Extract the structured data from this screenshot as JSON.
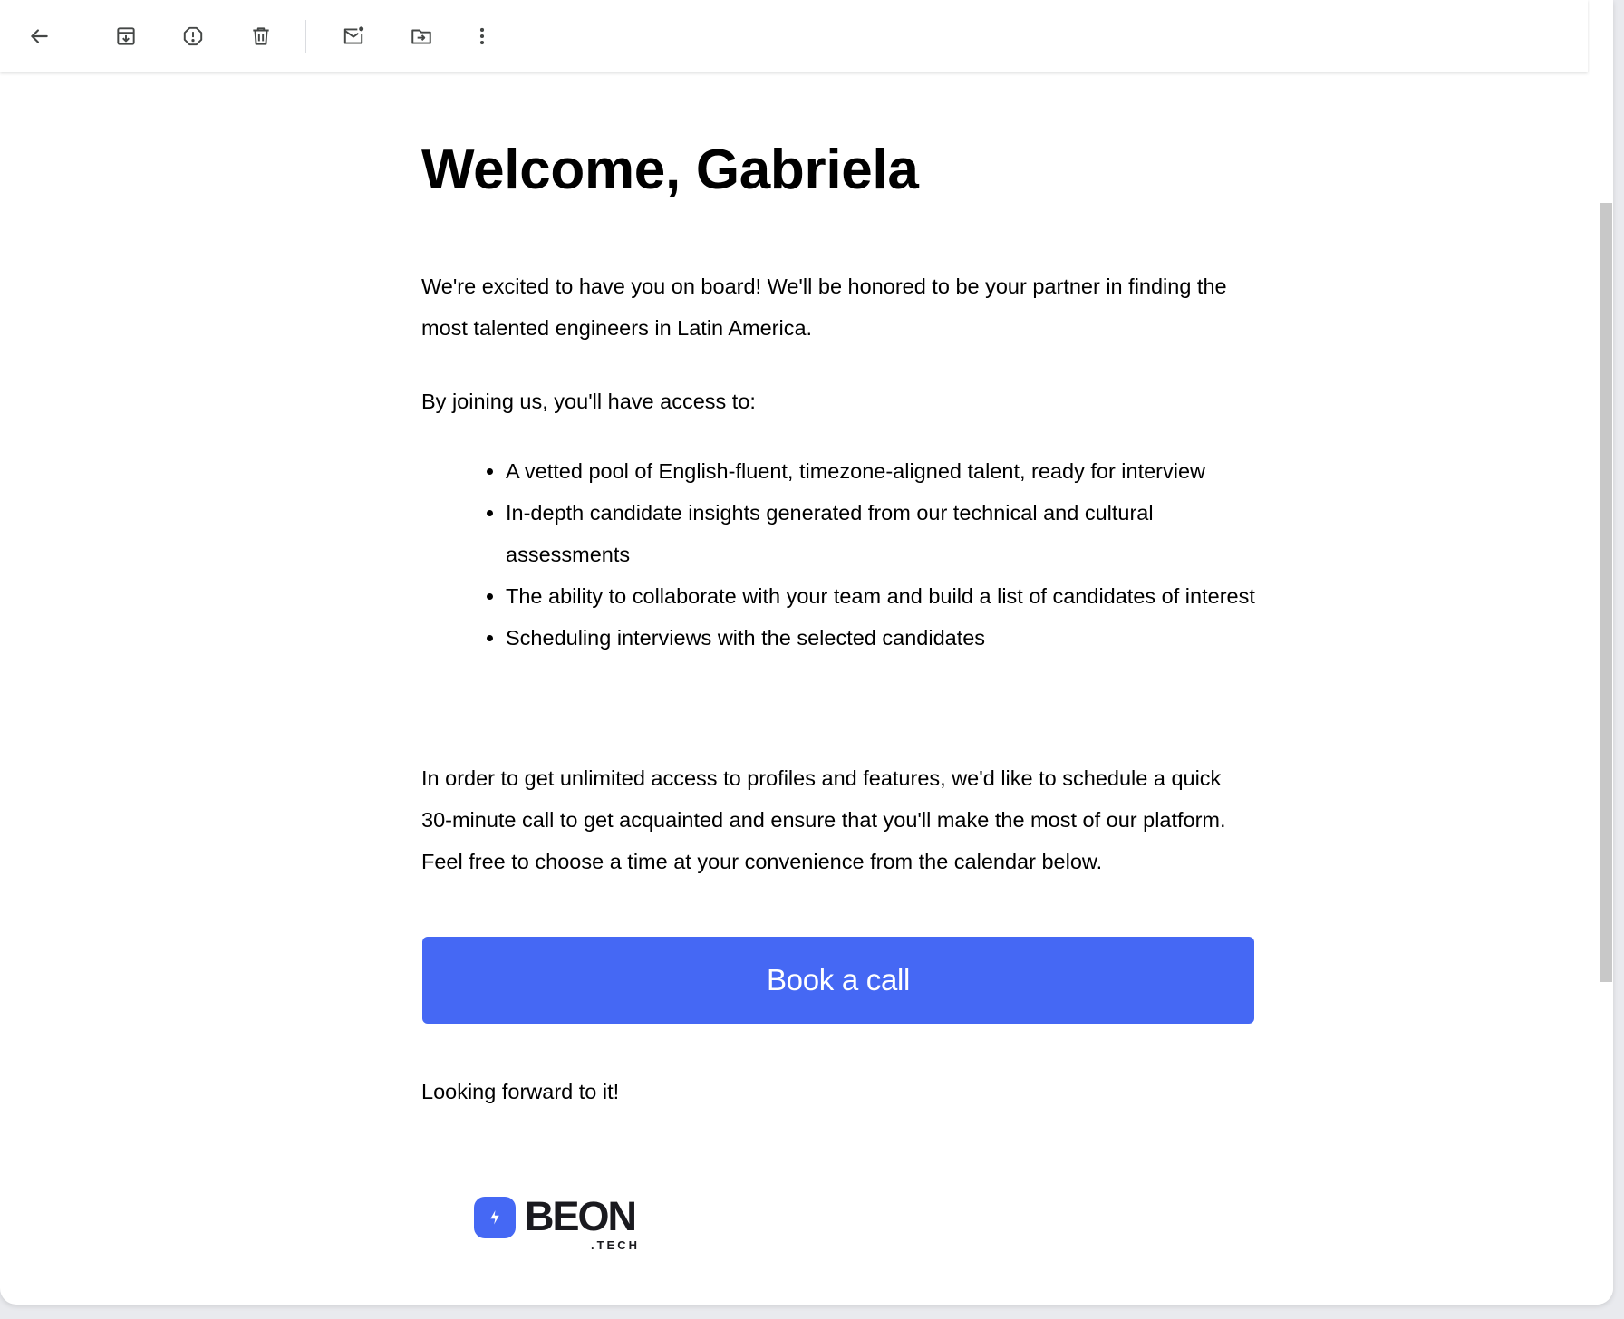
{
  "toolbar": {
    "back_icon": "arrow-left-icon",
    "archive_icon": "archive-icon",
    "report_spam_icon": "report-spam-icon",
    "delete_icon": "trash-icon",
    "mark_unread_icon": "mark-unread-icon",
    "move_to_icon": "move-to-folder-icon",
    "more_icon": "more-vertical-icon"
  },
  "email": {
    "heading": "Welcome, Gabriela",
    "intro": "We're excited to have you on board! We'll be honored to be your partner in finding the most talented engineers in Latin America.",
    "access_intro": "By joining us, you'll have access to:",
    "benefits": [
      "A vetted pool of English-fluent, timezone-aligned talent, ready for interview",
      "In-depth candidate insights generated from our technical and cultural assessments",
      "The ability to collaborate with your team and build a list of candidates of interest",
      "Scheduling interviews with the selected candidates"
    ],
    "call_paragraph": "In order to get unlimited access to profiles and features, we'd like to schedule a quick 30-minute call to get acquainted and ensure that you'll make the most of our platform. Feel free to choose a time at your convenience from the calendar below.",
    "cta_label": "Book a call",
    "closing": "Looking forward to it!",
    "logo": {
      "wordmark": "BEON",
      "suffix": ".TECH"
    }
  },
  "colors": {
    "accent": "#4568f4",
    "icon": "#444746"
  }
}
